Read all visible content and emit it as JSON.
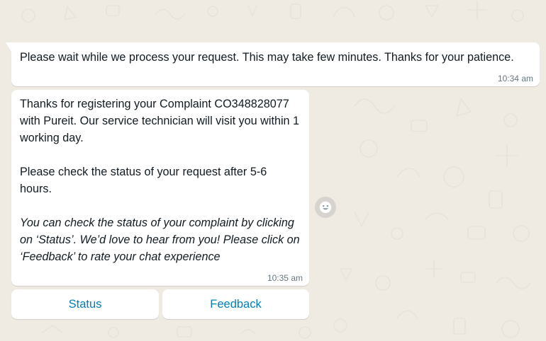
{
  "chat": {
    "messages": [
      {
        "text": "Please wait while we process your request. This may take few minutes. Thanks for your patience.",
        "time": "10:34 am"
      },
      {
        "paragraphs": [
          "Thanks for registering your Complaint CO348828077 with Pureit. Our service technician will visit you within 1 working day.",
          "Please check the status of your request after 5-6 hours.",
          "You can check the status of your complaint by clicking on ‘Status’. We’d love to hear from you! Please click on ‘Feedback’ to rate your chat experience"
        ],
        "time": "10:35 am"
      }
    ],
    "buttons": {
      "status": "Status",
      "feedback": "Feedback"
    },
    "reaction_icon": "smiley-icon"
  },
  "colors": {
    "background": "#efeae2",
    "bubble": "#ffffff",
    "text": "#111b21",
    "timestamp": "#667781",
    "button_text": "#027eb5",
    "reaction_bg": "#d7d3ce"
  }
}
